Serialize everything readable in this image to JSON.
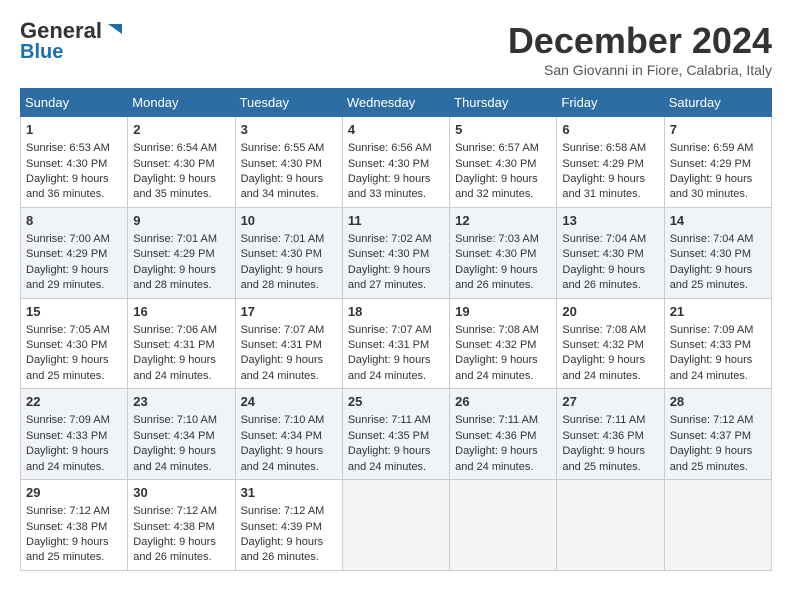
{
  "logo": {
    "general": "General",
    "blue": "Blue"
  },
  "header": {
    "month": "December 2024",
    "location": "San Giovanni in Fiore, Calabria, Italy"
  },
  "weekdays": [
    "Sunday",
    "Monday",
    "Tuesday",
    "Wednesday",
    "Thursday",
    "Friday",
    "Saturday"
  ],
  "weeks": [
    [
      {
        "day": "1",
        "sunrise": "6:53 AM",
        "sunset": "4:30 PM",
        "daylight": "9 hours and 36 minutes."
      },
      {
        "day": "2",
        "sunrise": "6:54 AM",
        "sunset": "4:30 PM",
        "daylight": "9 hours and 35 minutes."
      },
      {
        "day": "3",
        "sunrise": "6:55 AM",
        "sunset": "4:30 PM",
        "daylight": "9 hours and 34 minutes."
      },
      {
        "day": "4",
        "sunrise": "6:56 AM",
        "sunset": "4:30 PM",
        "daylight": "9 hours and 33 minutes."
      },
      {
        "day": "5",
        "sunrise": "6:57 AM",
        "sunset": "4:30 PM",
        "daylight": "9 hours and 32 minutes."
      },
      {
        "day": "6",
        "sunrise": "6:58 AM",
        "sunset": "4:29 PM",
        "daylight": "9 hours and 31 minutes."
      },
      {
        "day": "7",
        "sunrise": "6:59 AM",
        "sunset": "4:29 PM",
        "daylight": "9 hours and 30 minutes."
      }
    ],
    [
      {
        "day": "8",
        "sunrise": "7:00 AM",
        "sunset": "4:29 PM",
        "daylight": "9 hours and 29 minutes."
      },
      {
        "day": "9",
        "sunrise": "7:01 AM",
        "sunset": "4:29 PM",
        "daylight": "9 hours and 28 minutes."
      },
      {
        "day": "10",
        "sunrise": "7:01 AM",
        "sunset": "4:30 PM",
        "daylight": "9 hours and 28 minutes."
      },
      {
        "day": "11",
        "sunrise": "7:02 AM",
        "sunset": "4:30 PM",
        "daylight": "9 hours and 27 minutes."
      },
      {
        "day": "12",
        "sunrise": "7:03 AM",
        "sunset": "4:30 PM",
        "daylight": "9 hours and 26 minutes."
      },
      {
        "day": "13",
        "sunrise": "7:04 AM",
        "sunset": "4:30 PM",
        "daylight": "9 hours and 26 minutes."
      },
      {
        "day": "14",
        "sunrise": "7:04 AM",
        "sunset": "4:30 PM",
        "daylight": "9 hours and 25 minutes."
      }
    ],
    [
      {
        "day": "15",
        "sunrise": "7:05 AM",
        "sunset": "4:30 PM",
        "daylight": "9 hours and 25 minutes."
      },
      {
        "day": "16",
        "sunrise": "7:06 AM",
        "sunset": "4:31 PM",
        "daylight": "9 hours and 24 minutes."
      },
      {
        "day": "17",
        "sunrise": "7:07 AM",
        "sunset": "4:31 PM",
        "daylight": "9 hours and 24 minutes."
      },
      {
        "day": "18",
        "sunrise": "7:07 AM",
        "sunset": "4:31 PM",
        "daylight": "9 hours and 24 minutes."
      },
      {
        "day": "19",
        "sunrise": "7:08 AM",
        "sunset": "4:32 PM",
        "daylight": "9 hours and 24 minutes."
      },
      {
        "day": "20",
        "sunrise": "7:08 AM",
        "sunset": "4:32 PM",
        "daylight": "9 hours and 24 minutes."
      },
      {
        "day": "21",
        "sunrise": "7:09 AM",
        "sunset": "4:33 PM",
        "daylight": "9 hours and 24 minutes."
      }
    ],
    [
      {
        "day": "22",
        "sunrise": "7:09 AM",
        "sunset": "4:33 PM",
        "daylight": "9 hours and 24 minutes."
      },
      {
        "day": "23",
        "sunrise": "7:10 AM",
        "sunset": "4:34 PM",
        "daylight": "9 hours and 24 minutes."
      },
      {
        "day": "24",
        "sunrise": "7:10 AM",
        "sunset": "4:34 PM",
        "daylight": "9 hours and 24 minutes."
      },
      {
        "day": "25",
        "sunrise": "7:11 AM",
        "sunset": "4:35 PM",
        "daylight": "9 hours and 24 minutes."
      },
      {
        "day": "26",
        "sunrise": "7:11 AM",
        "sunset": "4:36 PM",
        "daylight": "9 hours and 24 minutes."
      },
      {
        "day": "27",
        "sunrise": "7:11 AM",
        "sunset": "4:36 PM",
        "daylight": "9 hours and 25 minutes."
      },
      {
        "day": "28",
        "sunrise": "7:12 AM",
        "sunset": "4:37 PM",
        "daylight": "9 hours and 25 minutes."
      }
    ],
    [
      {
        "day": "29",
        "sunrise": "7:12 AM",
        "sunset": "4:38 PM",
        "daylight": "9 hours and 25 minutes."
      },
      {
        "day": "30",
        "sunrise": "7:12 AM",
        "sunset": "4:38 PM",
        "daylight": "9 hours and 26 minutes."
      },
      {
        "day": "31",
        "sunrise": "7:12 AM",
        "sunset": "4:39 PM",
        "daylight": "9 hours and 26 minutes."
      },
      null,
      null,
      null,
      null
    ]
  ],
  "labels": {
    "sunrise": "Sunrise:",
    "sunset": "Sunset:",
    "daylight": "Daylight:"
  }
}
